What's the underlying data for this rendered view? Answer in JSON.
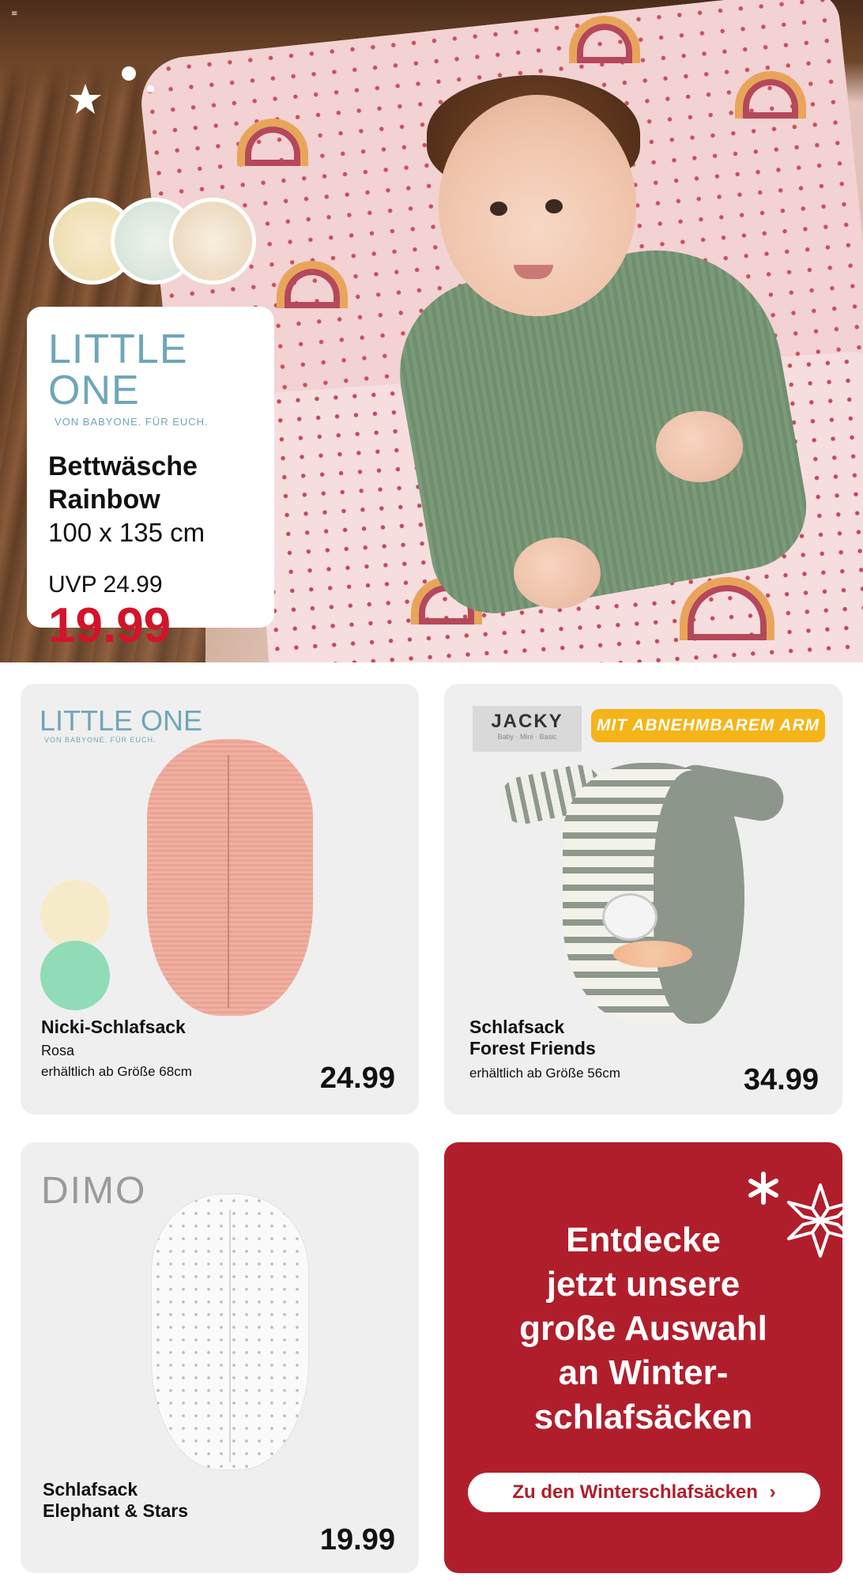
{
  "menu_icon": "menu-icon",
  "hero": {
    "brand_logo": "LITTLE ONE",
    "brand_sub": "VON BABYONE. FÜR EUCH.",
    "title_line1": "Bettwäsche",
    "title_line2": "Rainbow",
    "size": "100 x 135 cm",
    "uvp": "UVP 24.99",
    "price": "19.99",
    "price_color": "#d3132a"
  },
  "products": [
    {
      "brand_logo": "LITTLE ONE",
      "brand_sub": "VON BABYONE. FÜR EUCH.",
      "name": "Nicki-Schlafsack",
      "variant": "Rosa",
      "availability": "erhältlich ab Größe 68cm",
      "price": "24.99"
    },
    {
      "brand_logo": "JACKY",
      "brand_sub": "Baby · Mini · Basic",
      "badge": "MIT ABNEHMBAREM ARM",
      "name_line1": "Schlafsack",
      "name_line2": "Forest Friends",
      "availability": "erhältlich ab Größe 56cm",
      "price": "34.99"
    },
    {
      "brand_logo": "DIMO",
      "name_line1": "Schlafsack",
      "name_line2": "Elephant & Stars",
      "price": "19.99"
    }
  ],
  "promo": {
    "line1": "Entdecke",
    "line2": "jetzt unsere",
    "line3": "große Auswahl",
    "line4": "an Winter-",
    "line5": "schlafsäcken",
    "button_label": "Zu den Winterschlafsäcken",
    "button_icon": "chevron-right-icon",
    "background": "#b01e2c"
  }
}
